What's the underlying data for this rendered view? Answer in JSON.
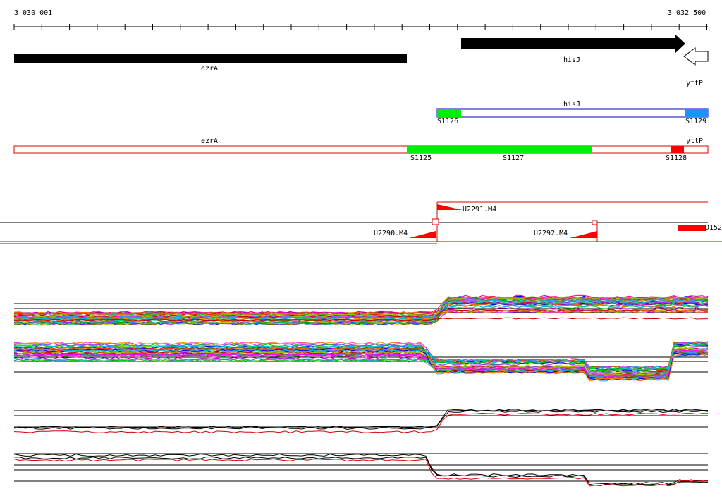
{
  "ruler": {
    "start_label": "3 030 001",
    "end_label": "3 032 500"
  },
  "genes": {
    "ezrA": "ezrA",
    "hisJ": "hisJ",
    "yttP": "yttP"
  },
  "transcripts": {
    "hisJ": "hisJ",
    "ezrA": "ezrA",
    "yttP": "yttP",
    "segments": [
      "S1126",
      "S1129",
      "S1125",
      "S1127",
      "S1128"
    ]
  },
  "probes": {
    "u2291": "U2291.M4",
    "u2290": "U2290.M4",
    "u2292": "U2292.M4",
    "d152": "D152"
  },
  "colors": {
    "gene_fill": "#000000",
    "segment_green": "#00ee00",
    "segment_blue": "#1e90ff",
    "segment_red": "#ff0000",
    "transcript_blue_outline": "#0000cc",
    "transcript_red_outline": "#dd0000"
  }
}
